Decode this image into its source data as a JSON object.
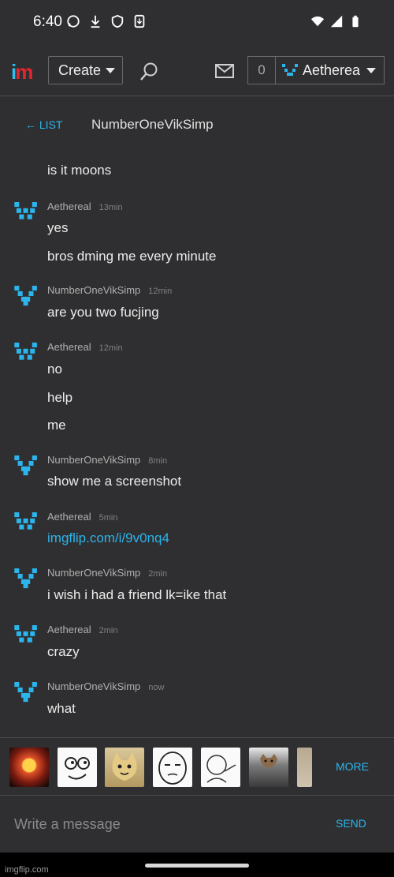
{
  "status_bar": {
    "time": "6:40",
    "left_icons": [
      "whatsapp-icon",
      "download-icon",
      "shield-icon",
      "download-box-icon"
    ],
    "right_icons": [
      "wifi-icon",
      "signal-icon",
      "battery-icon"
    ]
  },
  "header": {
    "logo": {
      "i": "i",
      "m": "m"
    },
    "create_label": "Create",
    "unread_count": "0",
    "user_label": "Aetherea"
  },
  "thread": {
    "back_label": "← LIST",
    "title": "NumberOneVikSimp"
  },
  "messages": [
    {
      "author": "",
      "ago": "",
      "texts": [
        "is it moons"
      ]
    },
    {
      "author": "Aethereal",
      "ago": "13min",
      "texts": [
        "yes",
        "bros dming me every minute"
      ]
    },
    {
      "author": "NumberOneVikSimp",
      "ago": "12min",
      "texts": [
        "are you two fucjing"
      ]
    },
    {
      "author": "Aethereal",
      "ago": "12min",
      "texts": [
        "no",
        "help",
        "me"
      ]
    },
    {
      "author": "NumberOneVikSimp",
      "ago": "8min",
      "texts": [
        "show me a screenshot"
      ]
    },
    {
      "author": "Aethereal",
      "ago": "5min",
      "texts": [
        "imgflip.com/i/9v0nq4"
      ]
    },
    {
      "author": "NumberOneVikSimp",
      "ago": "2min",
      "texts": [
        "i wish i had a friend lk=ike that"
      ]
    },
    {
      "author": "Aethereal",
      "ago": "2min",
      "texts": [
        "crazy"
      ]
    },
    {
      "author": "NumberOneVikSimp",
      "ago": "now",
      "texts": [
        "what"
      ]
    }
  ],
  "meme_bar": {
    "thumbnails": [
      "nuke-explosion-meme",
      "rage-face-meme",
      "happy-cat-meme",
      "okay-face-meme",
      "wojak-pointing-meme",
      "ceiling-cat-meme",
      "partial-meme"
    ],
    "more_label": "MORE"
  },
  "compose": {
    "placeholder": "Write a message",
    "send_label": "SEND"
  },
  "watermark": "imgflip.com",
  "colors": {
    "background": "#2f2f31",
    "accent": "#2bb5ec",
    "logo_red": "#e6262e"
  }
}
